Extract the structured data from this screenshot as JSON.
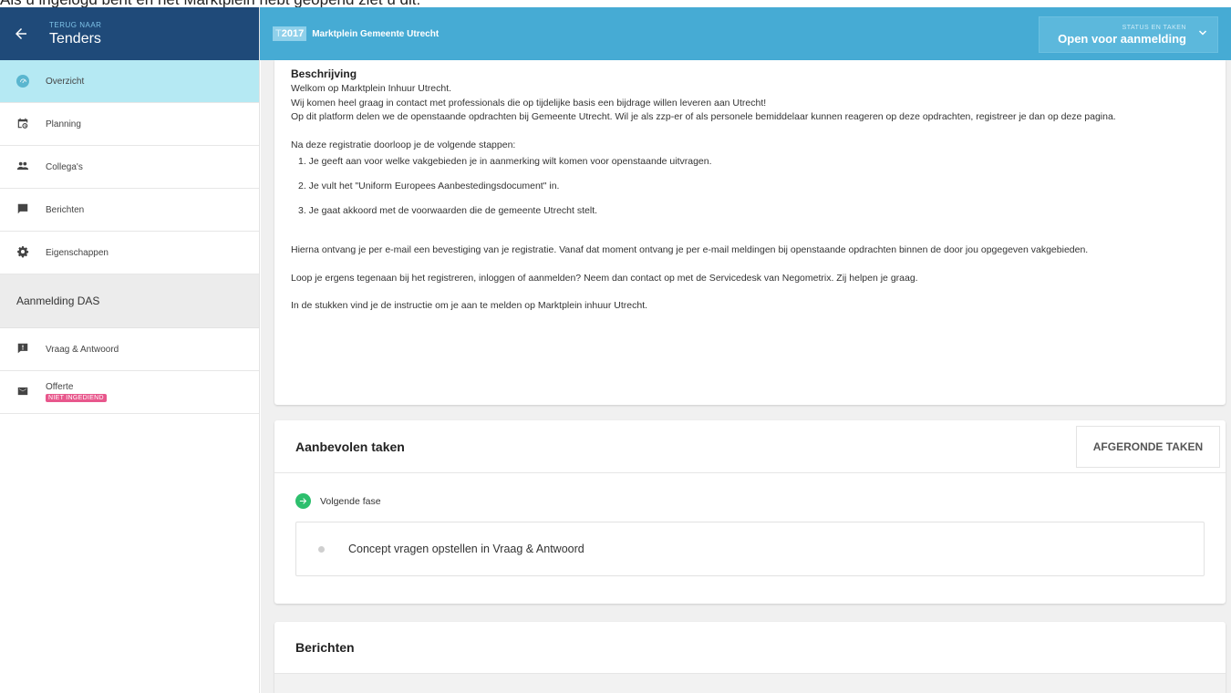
{
  "caption": "Als u ingelogd bent en het Marktplein hebt geopend ziet u dit:",
  "sidebar": {
    "back_small": "TERUG NAAR",
    "back_title": "Tenders",
    "items": [
      {
        "label": "Overzicht",
        "icon": "speedometer-icon"
      },
      {
        "label": "Planning",
        "icon": "calendar-clock-icon"
      },
      {
        "label": "Collega's",
        "icon": "people-icon"
      },
      {
        "label": "Berichten",
        "icon": "message-icon"
      },
      {
        "label": "Eigenschappen",
        "icon": "gear-icon"
      }
    ],
    "section": "Aanmelding DAS",
    "items2": [
      {
        "label": "Vraag & Antwoord",
        "icon": "chat-alert-icon"
      },
      {
        "label": "Offerte",
        "icon": "envelope-icon",
        "badge": "NIET INGEDIEND"
      }
    ]
  },
  "topbar": {
    "code_prefix": "T",
    "code": "2017",
    "title": "Marktplein Gemeente Utrecht",
    "status_small": "STATUS EN TAKEN",
    "status_main": "Open voor aanmelding"
  },
  "description": {
    "title": "Beschrijving",
    "lines": [
      "Welkom op Marktplein Inhuur Utrecht.",
      "Wij komen heel graag in contact met professionals die op tijdelijke basis een bijdrage willen leveren aan Utrecht!",
      "Op dit platform delen we de openstaande opdrachten bij Gemeente Utrecht. Wil je als zzp-er of als personele bemiddelaar kunnen reageren op deze opdrachten, registreer je dan op deze pagina."
    ],
    "intro_steps": "Na deze registratie doorloop je de volgende stappen:",
    "steps": [
      "1. Je geeft aan voor welke vakgebieden je in aanmerking wilt komen voor openstaande uitvragen.",
      "2. Je vult het \"Uniform Europees Aanbestedingsdocument\" in.",
      "3. Je gaat akkoord met de voorwaarden die de gemeente Utrecht stelt."
    ],
    "para1": "Hierna ontvang je per e-mail een bevestiging van je registratie. Vanaf dat moment ontvang je per e-mail meldingen bij openstaande opdrachten binnen de door jou opgegeven vakgebieden.",
    "para2": "Loop je ergens tegenaan bij het registreren, inloggen of aanmelden? Neem dan contact op met de Servicedesk van Negometrix. Zij helpen je graag.",
    "para3": "In de stukken vind je de instructie om je aan te melden op Marktplein inhuur Utrecht."
  },
  "tasks": {
    "title": "Aanbevolen taken",
    "done_button": "AFGERONDE TAKEN",
    "phase": "Volgende fase",
    "task": "Concept vragen opstellen in Vraag & Antwoord"
  },
  "messages": {
    "title": "Berichten"
  },
  "colors": {
    "sidebar_header": "#1f4a79",
    "topbar": "#46abd4",
    "active_item": "#b5e9f3",
    "phase_green": "#2dbf6d",
    "badge_pink": "#e8578c"
  }
}
